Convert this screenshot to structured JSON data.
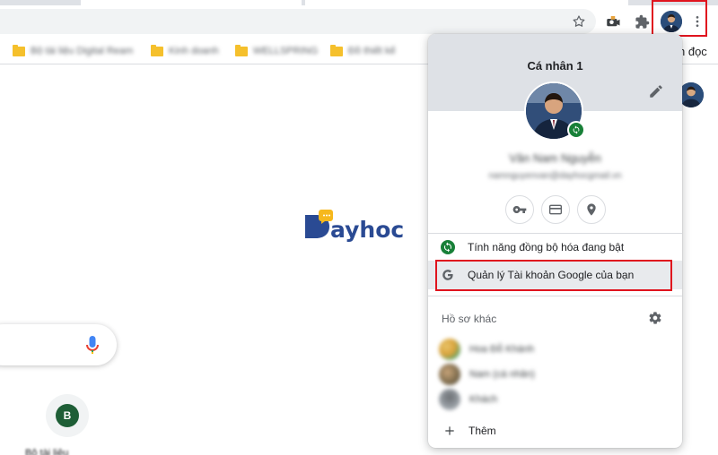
{
  "toolbar": {
    "bookmark_star_icon": "star-outline-icon",
    "extension_icon": "puzzle-icon",
    "menu_icon": "three-dot-menu-icon"
  },
  "bookmarks": {
    "items": [
      {
        "label": "Bộ tài liệu Digital Ream"
      },
      {
        "label": "Kinh doanh"
      },
      {
        "label": "WELLSPRING"
      },
      {
        "label": "Đồ thiết kế"
      }
    ],
    "reading_list_label": "h đọc"
  },
  "page": {
    "shortcut_letter": "B",
    "shortcut_label": "Bộ tài liệu"
  },
  "profile_menu": {
    "title": "Cá nhân 1",
    "user_name": "Văn Nam Nguyễn",
    "user_email": "namnguyenvan@dayhocgmail.vn",
    "sync_label": "Tính năng đồng bộ hóa đang bật",
    "google_account_label": "Quản lý Tài khoản Google của bạn",
    "other_profiles_title": "Hồ sơ khác",
    "other_profiles": [
      {
        "name": "Hoa Đỗ Khánh",
        "color": "#d9a23a"
      },
      {
        "name": "Nam (cá nhân)",
        "color": "#7b6a4c"
      },
      {
        "name": "Khách",
        "color": "#9aa0a6"
      }
    ],
    "add_label": "Thêm"
  },
  "colors": {
    "highlight": "#e0141e",
    "sync_green": "#188038",
    "brand_blue": "#2a4a93",
    "brand_yellow": "#f6b81d"
  }
}
